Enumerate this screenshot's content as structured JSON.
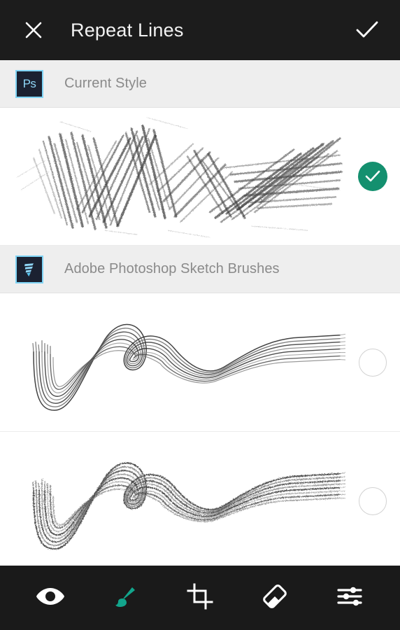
{
  "header": {
    "title": "Repeat Lines",
    "close_icon": "close-x-icon",
    "confirm_icon": "check-icon"
  },
  "sections": [
    {
      "label": "Current Style",
      "icon_name": "photoshop-app-icon",
      "icon_text": "Ps",
      "icon_border_color": "#7fd4f5",
      "icon_bg_color": "#1b2131",
      "brushes": [
        {
          "name": "current-style-brush-preview",
          "selected": true,
          "style": "charcoal-hatched-zigzag"
        }
      ]
    },
    {
      "label": "Adobe Photoshop Sketch Brushes",
      "icon_name": "photoshop-sketch-app-icon",
      "icon_text": "",
      "icon_border_color": "#7fd4f5",
      "icon_bg_color": "#1b2131",
      "brushes": [
        {
          "name": "sketch-brush-preview-smooth",
          "selected": false,
          "style": "smooth-parallel-wave"
        },
        {
          "name": "sketch-brush-preview-textured",
          "selected": false,
          "style": "grainy-parallel-wave"
        }
      ]
    }
  ],
  "toolbar": {
    "items": [
      {
        "name": "view-tool",
        "icon": "eye-icon",
        "active": false
      },
      {
        "name": "brush-tool",
        "icon": "brush-icon",
        "active": true
      },
      {
        "name": "crop-tool",
        "icon": "crop-icon",
        "active": false
      },
      {
        "name": "eraser-tool",
        "icon": "eraser-icon",
        "active": false
      },
      {
        "name": "adjustments-tool",
        "icon": "sliders-icon",
        "active": false
      }
    ]
  },
  "colors": {
    "header_bg": "#1c1c1c",
    "toolbar_bg": "#1a1a1a",
    "section_bg": "#eeeeee",
    "accent_teal": "#14906f",
    "active_tool_teal": "#12a58c",
    "label_gray": "#8a8a8a"
  }
}
